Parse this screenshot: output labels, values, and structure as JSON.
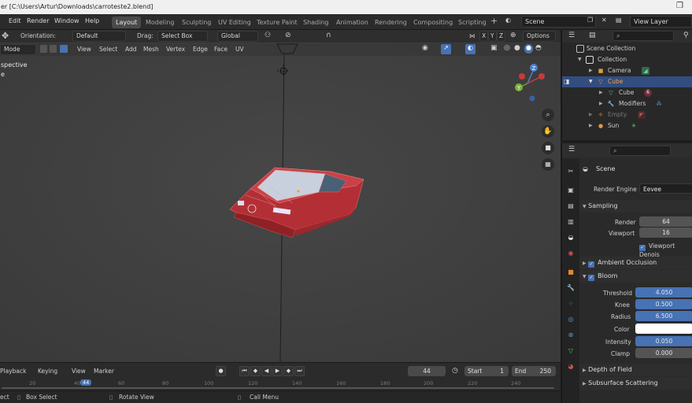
{
  "titlebar": {
    "title": "er [C:\\Users\\Artur\\Downloads\\carroteste2.blend]"
  },
  "menu": {
    "edit": "Edit",
    "render": "Render",
    "window": "Window",
    "help": "Help"
  },
  "workspaces": [
    "Layout",
    "Modeling",
    "Sculpting",
    "UV Editing",
    "Texture Paint",
    "Shading",
    "Animation",
    "Rendering",
    "Compositing",
    "Scripting"
  ],
  "scene": {
    "name": "Scene",
    "view_layer": "View Layer"
  },
  "toolbar": {
    "orientation_label": "Orientation:",
    "orientation_value": "Default",
    "drag_label": "Drag:",
    "drag_value": "Select Box",
    "transform_value": "Global",
    "options_label": "Options",
    "axis_x": "X",
    "axis_y": "Y",
    "axis_z": "Z"
  },
  "viewport_header": {
    "mode": "Mode",
    "view": "View",
    "select": "Select",
    "add": "Add",
    "mesh": "Mesh",
    "vertex": "Vertex",
    "edge": "Edge",
    "face": "Face",
    "uv": "UV"
  },
  "viewport": {
    "perspective_line1": "spective",
    "perspective_line2": "e"
  },
  "gizmo": {
    "x": "X",
    "y": "Y",
    "z": "Z"
  },
  "timeline": {
    "playback": "Playback",
    "keying": "Keying",
    "view": "View",
    "marker": "Marker",
    "current_frame": "44",
    "start_label": "Start",
    "start": "1",
    "end_label": "End",
    "end": "250",
    "ruler": [
      "20",
      "40",
      "60",
      "80",
      "100",
      "120",
      "140",
      "160",
      "180",
      "200",
      "220",
      "240"
    ],
    "ruler_current": "44"
  },
  "statusbar": {
    "select": "ect",
    "box_select": "Box Select",
    "rotate_view": "Rotate View",
    "call_menu": "Call Menu"
  },
  "outliner": {
    "items": [
      {
        "label": "Scene Collection"
      },
      {
        "label": "Collection"
      },
      {
        "label": "Camera"
      },
      {
        "label": "Cube"
      },
      {
        "label": "Cube"
      },
      {
        "label": "Modifiers"
      },
      {
        "label": "Empty"
      },
      {
        "label": "Sun"
      }
    ],
    "mesh_users": "6"
  },
  "properties": {
    "header": "Scene",
    "render_engine_label": "Render Engine",
    "render_engine": "Eevee",
    "sampling": "Sampling",
    "render_label": "Render",
    "render_value": "64",
    "viewport_label": "Viewport",
    "viewport_value": "16",
    "viewport_denoise": "Viewport Denois",
    "ambient_occlusion": "Ambient Occlusion",
    "bloom": "Bloom",
    "threshold_label": "Threshold",
    "threshold": "4.050",
    "knee_label": "Knee",
    "knee": "0.500",
    "radius_label": "Radius",
    "radius": "6.500",
    "color_label": "Color",
    "intensity_label": "Intensity",
    "intensity": "0.050",
    "clamp_label": "Clamp",
    "clamp": "0.000",
    "depth_of_field": "Depth of Field",
    "subsurface": "Subsurface Scattering"
  },
  "colors": {
    "accent": "#4772b3",
    "selection": "#334d80",
    "viewport_bg": "#3f3f3f",
    "car_red": "#c0343a"
  }
}
